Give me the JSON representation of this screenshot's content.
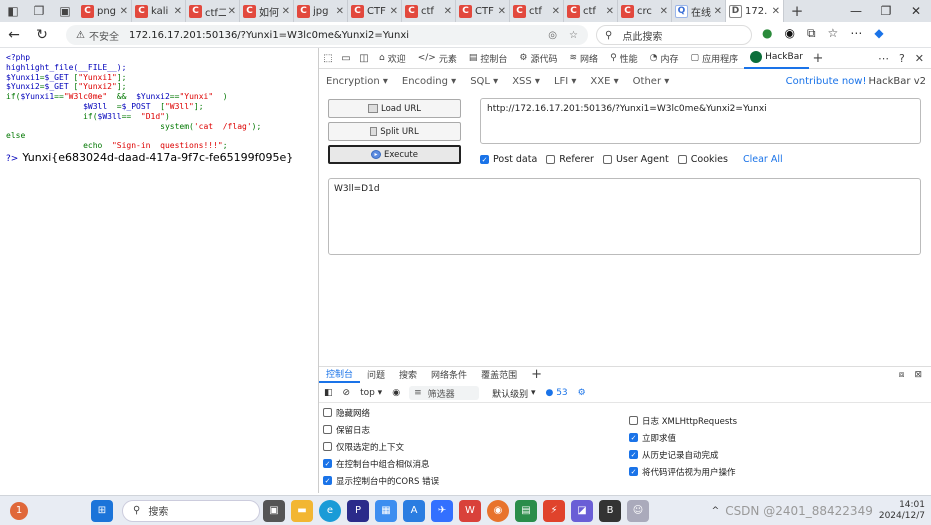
{
  "browser": {
    "tabs": [
      {
        "label": "png",
        "icon": "C"
      },
      {
        "label": "kali",
        "icon": "C"
      },
      {
        "label": "ctf二",
        "icon": "C"
      },
      {
        "label": "如何",
        "icon": "C"
      },
      {
        "label": "jpg",
        "icon": "C"
      },
      {
        "label": "CTF",
        "icon": "C"
      },
      {
        "label": "ctf",
        "icon": "C"
      },
      {
        "label": "CTF",
        "icon": "C"
      },
      {
        "label": "ctf",
        "icon": "C"
      },
      {
        "label": "ctf",
        "icon": "C"
      },
      {
        "label": "crc",
        "icon": "C"
      },
      {
        "label": "在线",
        "icon": "Q"
      },
      {
        "label": "172.",
        "icon": "D"
      }
    ],
    "security_label": "不安全",
    "url": "172.16.17.201:50136/?Yunxi1=W3lc0me&Yunxi2=Yunxi",
    "search_placeholder": "点此搜索"
  },
  "page": {
    "source_lines": [
      [
        {
          "t": "<?php",
          "c": "def"
        }
      ],
      [
        {
          "t": "highlight_file(__FILE__);",
          "c": "def"
        }
      ],
      [
        {
          "t": "$Yunxi1",
          "c": "def"
        },
        {
          "t": "=",
          "c": "kw"
        },
        {
          "t": "$_GET ",
          "c": "def"
        },
        {
          "t": "[",
          "c": "kw"
        },
        {
          "t": "\"Yunxi1\"",
          "c": "str"
        },
        {
          "t": "];",
          "c": "kw"
        }
      ],
      [
        {
          "t": "$Yunxi2",
          "c": "def"
        },
        {
          "t": "=",
          "c": "kw"
        },
        {
          "t": "$_GET ",
          "c": "def"
        },
        {
          "t": "[",
          "c": "kw"
        },
        {
          "t": "\"Yunxi2\"",
          "c": "str"
        },
        {
          "t": "];",
          "c": "kw"
        }
      ],
      [
        {
          "t": "if(",
          "c": "kw"
        },
        {
          "t": "$Yunxi1",
          "c": "def"
        },
        {
          "t": "==",
          "c": "kw"
        },
        {
          "t": "\"W3lc0me\"",
          "c": "str"
        },
        {
          "t": "  &&  ",
          "c": "kw"
        },
        {
          "t": "$Yunxi2",
          "c": "def"
        },
        {
          "t": "==",
          "c": "kw"
        },
        {
          "t": "\"Yunxi\"",
          "c": "str"
        },
        {
          "t": "  )",
          "c": "kw"
        }
      ],
      [
        {
          "t": "                $W3ll  ",
          "c": "def"
        },
        {
          "t": "=",
          "c": "kw"
        },
        {
          "t": "$_POST  ",
          "c": "def"
        },
        {
          "t": "[",
          "c": "kw"
        },
        {
          "t": "\"W3ll\"",
          "c": "str"
        },
        {
          "t": "];",
          "c": "kw"
        }
      ],
      [
        {
          "t": "                if(",
          "c": "kw"
        },
        {
          "t": "$W3ll",
          "c": "def"
        },
        {
          "t": "==  ",
          "c": "kw"
        },
        {
          "t": "\"D1d\"",
          "c": "str"
        },
        {
          "t": ")",
          "c": "kw"
        }
      ],
      [
        {
          "t": "                                system(",
          "c": "kw"
        },
        {
          "t": "'cat  /flag'",
          "c": "str"
        },
        {
          "t": ");",
          "c": "kw"
        }
      ],
      [
        {
          "t": "else",
          "c": "kw"
        }
      ],
      [
        {
          "t": "                echo  ",
          "c": "kw"
        },
        {
          "t": "\"Sign-in  questions!!!\"",
          "c": "str"
        },
        {
          "t": ";",
          "c": "kw"
        }
      ]
    ],
    "prompt_symbol": "?>",
    "flag_output": "Yunxi{e683024d-daad-417a-9f7c-fe65199f095e}"
  },
  "devtools": {
    "tabs": [
      "欢迎",
      "元素",
      "控制台",
      "源代码",
      "网络",
      "性能",
      "内存",
      "应用程序",
      "HackBar"
    ],
    "active_tab": "HackBar"
  },
  "hackbar": {
    "menu": [
      "Encryption",
      "Encoding",
      "SQL",
      "XSS",
      "LFI",
      "XXE",
      "Other"
    ],
    "contribute": "Contribute now!",
    "version": "HackBar v2",
    "load_url": "Load URL",
    "split_url": "Split URL",
    "execute": "Execute",
    "url_value": "http://172.16.17.201:50136/?Yunxi1=W3lc0me&Yunxi2=Yunxi",
    "options": {
      "post_data": {
        "label": "Post data",
        "checked": true
      },
      "referer": {
        "label": "Referer",
        "checked": false
      },
      "user_agent": {
        "label": "User Agent",
        "checked": false
      },
      "cookies": {
        "label": "Cookies",
        "checked": false
      }
    },
    "clear_all": "Clear All",
    "post_body": "W3ll=D1d"
  },
  "console": {
    "tabs": [
      "控制台",
      "问题",
      "搜索",
      "网络条件",
      "覆盖范围"
    ],
    "context": "top",
    "filter_placeholder": "筛选器",
    "level": "默认级别",
    "issue_count": "53",
    "settings_left": [
      {
        "label": "隐藏网络",
        "checked": false
      },
      {
        "label": "保留日志",
        "checked": false
      },
      {
        "label": "仅限选定的上下文",
        "checked": false
      },
      {
        "label": "在控制台中组合相似消息",
        "checked": true
      },
      {
        "label": "显示控制台中的CORS 错误",
        "checked": true
      }
    ],
    "settings_right": [
      {
        "label": "日志 XMLHttpRequests",
        "checked": false
      },
      {
        "label": "立即求值",
        "checked": true
      },
      {
        "label": "从历史记录自动完成",
        "checked": true
      },
      {
        "label": "将代码评估视为用户操作",
        "checked": true
      }
    ]
  },
  "taskbar": {
    "search_label": "搜索",
    "watermark": "CSDN @2401_88422349",
    "time": "14:01",
    "date": "2024/12/7"
  },
  "colors": {
    "accent": "#1a73e8",
    "php_default": "#0000bb",
    "php_string": "#dd0000",
    "php_keyword": "#007700"
  }
}
